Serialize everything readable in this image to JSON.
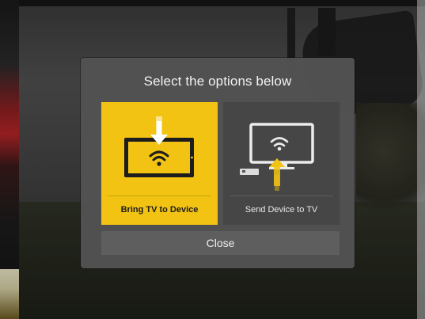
{
  "dialog": {
    "title": "Select the options below",
    "options": [
      {
        "label": "Bring TV to Device",
        "icon": "tablet-wifi-icon",
        "selected": true
      },
      {
        "label": "Send Device to TV",
        "icon": "tv-wifi-icon",
        "selected": false
      }
    ],
    "close_label": "Close"
  },
  "colors": {
    "accent": "#f2c313",
    "dialog_bg": "#525252",
    "option_bg": "#464646",
    "close_bg": "#5e5e5e"
  }
}
